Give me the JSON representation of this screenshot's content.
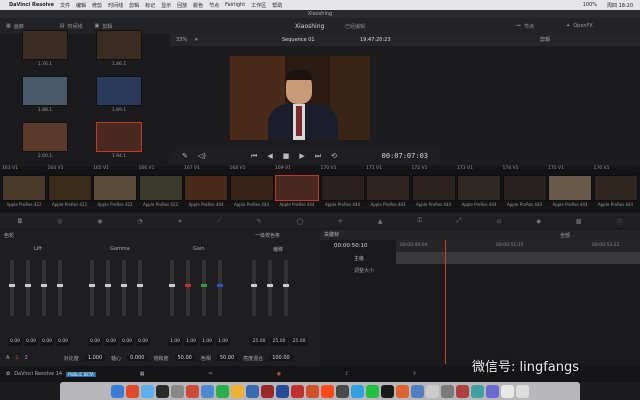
{
  "menubar": {
    "app": "DaVinci Resolve",
    "items": [
      "文件",
      "编辑",
      "修剪",
      "时间线",
      "剪辑",
      "标记",
      "显示",
      "回放",
      "颜色",
      "节点",
      "Fairlight",
      "工作区",
      "帮助"
    ],
    "right": [
      "100%",
      "周四 18:20"
    ]
  },
  "window_title": "Xiaoshing",
  "topnav": {
    "media": "画廊",
    "timeline": "时间线",
    "clips": "剪辑",
    "project": "Xiaoshing",
    "status": "已经编辑",
    "nodes": "节点",
    "openfx": "OpenFX"
  },
  "media_thumbs": [
    {
      "label": "1.76.1"
    },
    {
      "label": "1.86.1"
    },
    {
      "label": "1.88.1"
    },
    {
      "label": "1.89.1"
    },
    {
      "label": "2.60.1"
    },
    {
      "label": "1.94.1"
    }
  ],
  "viewer": {
    "zoom": "33%",
    "sequence": "Sequence 01",
    "timecode_top": "19:47:20:23",
    "timecode": "00:07:07:03",
    "clip_label": "剪辑"
  },
  "clips": [
    {
      "num": "163",
      "track": "V1",
      "label": "Apple ProRes 422"
    },
    {
      "num": "164",
      "track": "V1",
      "label": "Apple ProRes 422"
    },
    {
      "num": "165",
      "track": "V1",
      "label": "Apple ProRes 422"
    },
    {
      "num": "166",
      "track": "V1",
      "label": "Apple ProRes 422"
    },
    {
      "num": "167",
      "track": "V1",
      "label": "Apple ProRes 444"
    },
    {
      "num": "168",
      "track": "V1",
      "label": "Apple ProRes 444"
    },
    {
      "num": "169",
      "track": "V1",
      "label": "Apple ProRes 444"
    },
    {
      "num": "170",
      "track": "V1",
      "label": "Apple ProRes 444"
    },
    {
      "num": "171",
      "track": "V1",
      "label": "Apple ProRes 444"
    },
    {
      "num": "172",
      "track": "V1",
      "label": "Apple ProRes 444"
    },
    {
      "num": "173",
      "track": "V1",
      "label": "Apple ProRes 444"
    },
    {
      "num": "174",
      "track": "V1",
      "label": "Apple ProRes 444"
    },
    {
      "num": "175",
      "track": "V1",
      "label": "Apple ProRes 444"
    },
    {
      "num": "176",
      "track": "V1",
      "label": "Apple ProRes 444"
    }
  ],
  "color_panel": {
    "title": "色轮",
    "mode": "一级校色条",
    "wheels": [
      {
        "name": "Lift",
        "values": [
          "0.00",
          "0.00",
          "0.00",
          "0.00"
        ]
      },
      {
        "name": "Gamma",
        "values": [
          "0.00",
          "0.00",
          "0.00",
          "0.00"
        ]
      },
      {
        "name": "Gain",
        "values": [
          "1.00",
          "1.00",
          "1.00",
          "1.00"
        ]
      },
      {
        "name": "偏移",
        "values": [
          "25.00",
          "25.00",
          "25.00"
        ]
      }
    ],
    "bottom": {
      "a_label": "A",
      "page1": "1",
      "page2": "2",
      "contrast_label": "对比度",
      "contrast": "1.000",
      "pivot_label": "轴心",
      "pivot": "0.000",
      "sat_label": "饱和度",
      "sat": "50.00",
      "hue_label": "色相",
      "hue": "50.00",
      "lum_label": "亮度混合",
      "lum": "100.00"
    }
  },
  "keyframes": {
    "title": "关键帧",
    "filter": "全部",
    "tc_main": "00:00:50:10",
    "ruler": [
      "00:00:49:04",
      "00:00:51:15",
      "00:00:53:22"
    ],
    "row1": "主级",
    "row2": "调整大小"
  },
  "statusbar": {
    "app": "DaVinci Resolve 14",
    "badge": "PUBLIC BETA"
  },
  "watermark": "微信号: lingfangs",
  "dock_colors": [
    "#3a7bd5",
    "#e04a2a",
    "#5ab0f0",
    "#2a2a2a",
    "#888",
    "#d04a3a",
    "#4a8ad0",
    "#2ab04a",
    "#f0b030",
    "#3a6ab0",
    "#9a2a2a",
    "#2a4a9a",
    "#c0302a",
    "#d0502a",
    "#ff4a1a",
    "#4a4a4a",
    "#30a0e0",
    "#20c040",
    "#1a1a1a",
    "#e06030",
    "#5080c0",
    "#cccccc",
    "#7a7a7a",
    "#b04040",
    "#40a0a0",
    "#6a6ad0",
    "#e8e8e8",
    "#dddddd"
  ]
}
